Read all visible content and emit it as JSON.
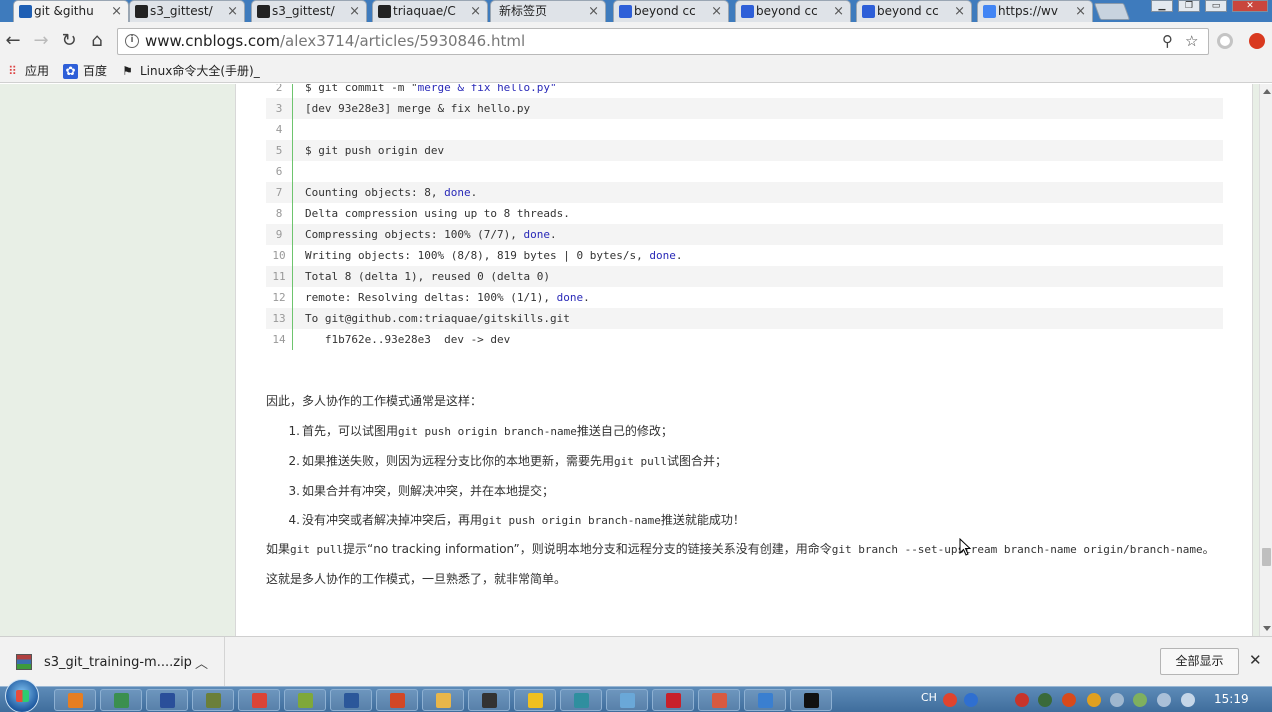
{
  "tabs": [
    {
      "title": "git &githu",
      "icon": "cnblogs-icon",
      "color": "#1f5fb4",
      "active": true
    },
    {
      "title": "s3_gittest/",
      "icon": "github-icon",
      "color": "#222222",
      "active": false
    },
    {
      "title": "s3_gittest/",
      "icon": "github-icon",
      "color": "#222222",
      "active": false
    },
    {
      "title": "triaquae/C",
      "icon": "github-icon",
      "color": "#222222",
      "active": false
    },
    {
      "title": "新标签页",
      "icon": "none",
      "color": "",
      "active": false
    },
    {
      "title": "beyond cc",
      "icon": "baidu-paw-icon",
      "color": "#2e5fd8",
      "active": false
    },
    {
      "title": "beyond cc",
      "icon": "baidu-paw-icon",
      "color": "#2e5fd8",
      "active": false
    },
    {
      "title": "beyond cc",
      "icon": "baidu-paw-icon",
      "color": "#2e5fd8",
      "active": false
    },
    {
      "title": "https://wv",
      "icon": "google-icon",
      "color": "#4285f4",
      "active": false
    }
  ],
  "address_bar": {
    "host": "www.cnblogs.com",
    "path": "/alex3714/articles/5930846.html"
  },
  "bookmarks": {
    "apps": "应用",
    "baidu": "百度",
    "linux": "Linux命令大全(手册)_"
  },
  "code_lines": [
    {
      "n": "2",
      "parts": [
        {
          "t": "$ git commit -m \""
        },
        {
          "t": "merge & fix hello.py\"",
          "c": "str"
        }
      ]
    },
    {
      "n": "3",
      "parts": [
        {
          "t": "[dev 93e28e3] merge & fix hello.py"
        }
      ]
    },
    {
      "n": "4",
      "parts": [
        {
          "t": ""
        }
      ]
    },
    {
      "n": "5",
      "parts": [
        {
          "t": "$ git push origin dev"
        }
      ]
    },
    {
      "n": "6",
      "parts": [
        {
          "t": ""
        }
      ]
    },
    {
      "n": "7",
      "parts": [
        {
          "t": "Counting objects: 8, "
        },
        {
          "t": "done",
          "c": "kw"
        },
        {
          "t": "."
        }
      ]
    },
    {
      "n": "8",
      "parts": [
        {
          "t": "Delta compression using up to 8 threads."
        }
      ]
    },
    {
      "n": "9",
      "parts": [
        {
          "t": "Compressing objects: 100% (7/7), "
        },
        {
          "t": "done",
          "c": "kw"
        },
        {
          "t": "."
        }
      ]
    },
    {
      "n": "10",
      "parts": [
        {
          "t": "Writing objects: 100% (8/8), 819 bytes | 0 bytes/s, "
        },
        {
          "t": "done",
          "c": "kw"
        },
        {
          "t": "."
        }
      ]
    },
    {
      "n": "11",
      "parts": [
        {
          "t": "Total 8 (delta 1), reused 0 (delta 0)"
        }
      ]
    },
    {
      "n": "12",
      "parts": [
        {
          "t": "remote: Resolving deltas: 100% (1/1), "
        },
        {
          "t": "done",
          "c": "kw"
        },
        {
          "t": "."
        }
      ]
    },
    {
      "n": "13",
      "parts": [
        {
          "t": "To git@github.com:triaquae/gitskills.git"
        }
      ]
    },
    {
      "n": "14",
      "parts": [
        {
          "t": "   f1b762e..93e28e3  dev -> dev"
        }
      ]
    }
  ],
  "prose": {
    "intro": "因此，多人协作的工作模式通常是这样：",
    "steps": [
      {
        "num": "1.",
        "parts": [
          {
            "t": "首先，可以试图用"
          },
          {
            "t": "git push origin branch-name",
            "m": true
          },
          {
            "t": "推送自己的修改；"
          }
        ]
      },
      {
        "num": "2.",
        "parts": [
          {
            "t": "如果推送失败，则因为远程分支比你的本地更新，需要先用"
          },
          {
            "t": "git pull",
            "m": true
          },
          {
            "t": "试图合并；"
          }
        ]
      },
      {
        "num": "3.",
        "parts": [
          {
            "t": "如果合并有冲突，则解决冲突，并在本地提交；"
          }
        ]
      },
      {
        "num": "4.",
        "parts": [
          {
            "t": "没有冲突或者解决掉冲突后，再用"
          },
          {
            "t": "git push origin branch-name",
            "m": true
          },
          {
            "t": "推送就能成功！"
          }
        ]
      }
    ],
    "note_parts": [
      {
        "t": "如果"
      },
      {
        "t": "git pull",
        "m": true
      },
      {
        "t": "提示“no tracking information”，则说明本地分支和远程分支的链接关系没有创建，用命令"
      },
      {
        "t": "git branch --set-upstream branch-name origin/branch-name",
        "m": true
      },
      {
        "t": "。"
      }
    ],
    "outro": "这就是多人协作的工作模式，一旦熟悉了，就非常简单。"
  },
  "download_bar": {
    "filename": "s3_git_training-m....zip",
    "show_all": "全部显示"
  },
  "taskbar": {
    "ime": "CH",
    "clock": "15:19"
  }
}
